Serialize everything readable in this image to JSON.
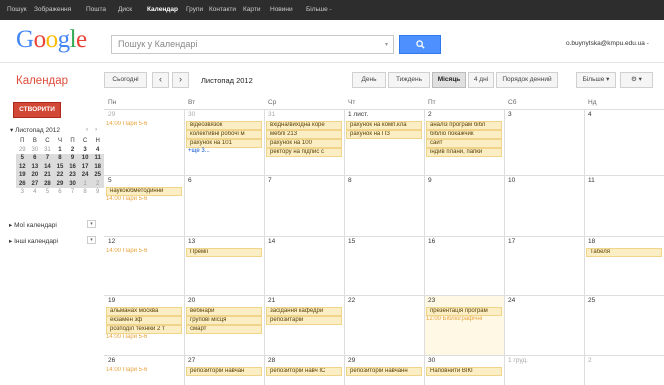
{
  "topbar": {
    "items": [
      "Пошук",
      "Зображення",
      "Пошта",
      "Диск",
      "Календар",
      "Групи",
      "Контакти",
      "Карти",
      "Новини",
      "Більше -"
    ],
    "active_index": 4
  },
  "header": {
    "logo": "Google",
    "search_placeholder": "Пошук у Календарі",
    "search_dropdown": "▾",
    "search_button": "🔍",
    "user_email": "o.buynytska@kmpu.edu.ua -"
  },
  "toolbar": {
    "app_title": "Календар",
    "today": "Сьогодні",
    "prev": "‹",
    "next": "›",
    "date_range": "Листопад 2012",
    "views": [
      "День",
      "Тиждень",
      "Місяць",
      "4 дні",
      "Порядок денний"
    ],
    "selected_view": 2,
    "more": "Більше ▾",
    "settings": "⚙ ▾"
  },
  "sidebar": {
    "create": "СТВОРИТИ",
    "mini_title": "▾ Листопад 2012",
    "mini_prev": "‹",
    "mini_next": "›",
    "weekday_heads": [
      "П",
      "В",
      "С",
      "Ч",
      "П",
      "С",
      "Н"
    ],
    "weeks": [
      [
        "29",
        "30",
        "31",
        "1",
        "2",
        "3",
        "4"
      ],
      [
        "5",
        "6",
        "7",
        "8",
        "9",
        "10",
        "11"
      ],
      [
        "12",
        "13",
        "14",
        "15",
        "16",
        "17",
        "18"
      ],
      [
        "19",
        "20",
        "21",
        "22",
        "23",
        "24",
        "25"
      ],
      [
        "26",
        "27",
        "28",
        "29",
        "30",
        "1",
        "2"
      ],
      [
        "3",
        "4",
        "5",
        "6",
        "7",
        "8",
        "9"
      ]
    ],
    "my_calendars": "▸ Мої календарі",
    "other_calendars": "▸ Інші календарі",
    "toggle": "▾"
  },
  "grid": {
    "col_headers": [
      "Пн",
      "Вт",
      "Ср",
      "Чт",
      "Пт",
      "Сб",
      "Нд"
    ],
    "weeks": [
      {
        "days": [
          "29",
          "30",
          "31",
          "1 лист.",
          "2",
          "3",
          "4"
        ],
        "events": [
          {
            "col": 0,
            "row": 0,
            "text": "14:00 Пари 5-6",
            "timed": true
          },
          {
            "col": 1,
            "row": 0,
            "text": "відеозвязок"
          },
          {
            "col": 1,
            "row": 1,
            "text": "колективні робочі м"
          },
          {
            "col": 1,
            "row": 2,
            "text": "рахунок на 101"
          },
          {
            "col": 2,
            "row": 0,
            "text": "вхідна/вихідна коре"
          },
          {
            "col": 2,
            "row": 1,
            "text": "меблі 213"
          },
          {
            "col": 2,
            "row": 2,
            "text": "рахунок на 100"
          },
          {
            "col": 2,
            "row": 3,
            "text": "ректору на підпис с"
          },
          {
            "col": 3,
            "row": 0,
            "text": "рахунок на комп.кла"
          },
          {
            "col": 3,
            "row": 1,
            "text": "рахунок на ПЗ"
          },
          {
            "col": 4,
            "row": 0,
            "text": "аналіз програм бібл"
          },
          {
            "col": 4,
            "row": 1,
            "text": "бібліо покажчик"
          },
          {
            "col": 4,
            "row": 2,
            "text": "сайт"
          },
          {
            "col": 4,
            "row": 3,
            "text": "індив плани, папки"
          }
        ],
        "more": "+ще 3..."
      },
      {
        "days": [
          "5",
          "6",
          "7",
          "8",
          "9",
          "10",
          "11"
        ],
        "events": [
          {
            "col": 0,
            "row": 0,
            "text": "наукоюбметодинни"
          },
          {
            "col": 0,
            "row": 1,
            "text": "14:00 Пари 5-6",
            "timed": true
          }
        ]
      },
      {
        "days": [
          "12",
          "13",
          "14",
          "15",
          "16",
          "17",
          "18"
        ],
        "events": [
          {
            "col": 0,
            "row": 0,
            "text": "14:00 Пари 5-6",
            "timed": true
          },
          {
            "col": 1,
            "row": 0,
            "text": "Премії"
          },
          {
            "col": 6,
            "row": 0,
            "text": "Табеля"
          }
        ]
      },
      {
        "days": [
          "19",
          "20",
          "21",
          "22",
          "23",
          "24",
          "25"
        ],
        "events": [
          {
            "col": 0,
            "row": 0,
            "text": "альманах москва"
          },
          {
            "col": 0,
            "row": 1,
            "text": "екзамен зф"
          },
          {
            "col": 0,
            "row": 2,
            "text": "розподіл техніки 2 т"
          },
          {
            "col": 0,
            "row": 3,
            "text": "14:00 Пари 5-6",
            "timed": true
          },
          {
            "col": 1,
            "row": 0,
            "text": "вебінари"
          },
          {
            "col": 1,
            "row": 1,
            "text": "групові місця"
          },
          {
            "col": 1,
            "row": 2,
            "text": "смарт"
          },
          {
            "col": 2,
            "row": 0,
            "text": "засідання кафедри"
          },
          {
            "col": 2,
            "row": 1,
            "text": "репозитарій"
          },
          {
            "col": 4,
            "row": 0,
            "text": "презентація програм"
          },
          {
            "col": 4,
            "row": 1,
            "text": "12:00 Бібліографічні",
            "timed": true
          }
        ]
      },
      {
        "days": [
          "26",
          "27",
          "28",
          "29",
          "30",
          "1 груд.",
          "2"
        ],
        "events": [
          {
            "col": 0,
            "row": 0,
            "text": "14:00 Пари 5-6",
            "timed": true
          },
          {
            "col": 1,
            "row": 0,
            "text": "репозиторій навчан"
          },
          {
            "col": 2,
            "row": 0,
            "text": "репозиторій навч ІС"
          },
          {
            "col": 3,
            "row": 0,
            "text": "репозиторій навчанн"
          },
          {
            "col": 4,
            "row": 0,
            "text": "Наповнити ВІКІ"
          }
        ]
      }
    ]
  },
  "colors": {
    "accent": "#dd4b39",
    "event_bg": "#fbeec4",
    "event_border": "#f0d48a",
    "timed": "#e8a33b",
    "search_blue": "#4d90fe"
  }
}
